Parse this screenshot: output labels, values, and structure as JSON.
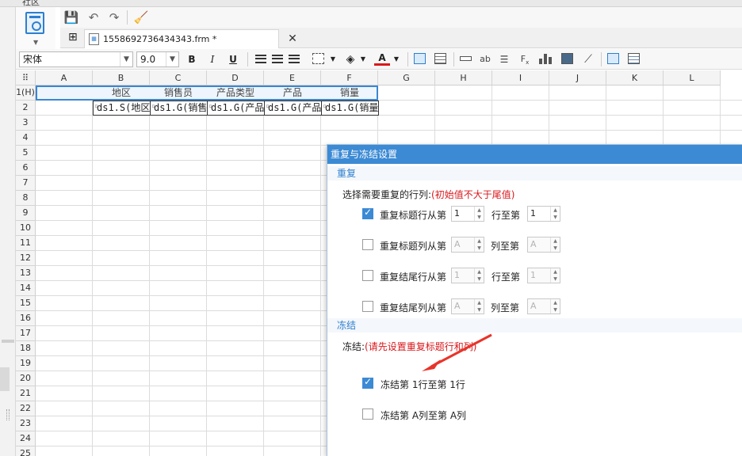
{
  "top_strip": {
    "text": "社区"
  },
  "tab": {
    "file_name": "1558692736434343.frm *"
  },
  "format_bar": {
    "font_name": "宋体",
    "font_size": "9.0"
  },
  "grid": {
    "columns": [
      "A",
      "B",
      "C",
      "D",
      "E",
      "F",
      "G",
      "H",
      "I",
      "J",
      "K",
      "L"
    ],
    "rows": [
      "1(H)",
      "2",
      "3",
      "4",
      "5",
      "6",
      "7",
      "8",
      "9",
      "10",
      "11",
      "12",
      "13",
      "14",
      "15",
      "16",
      "17",
      "18",
      "19",
      "20",
      "21",
      "22",
      "23",
      "24",
      "25"
    ],
    "header_row": [
      "地区",
      "销售员",
      "产品类型",
      "产品",
      "销量"
    ],
    "data_row": [
      "ds1.S(地区)",
      "ds1.G(销售",
      "ds1.G(产品",
      "ds1.G(产品)",
      "ds1.G(销量)"
    ]
  },
  "dialog": {
    "title": "重复与冻结设置",
    "repeat_section": "重复",
    "repeat_prompt": "选择需要重复的行列:",
    "repeat_hint": "(初始值不大于尾值)",
    "options": [
      {
        "label": "重复标题行从第",
        "checked": true,
        "from": "1",
        "to_label": "行至第",
        "to": "1",
        "enabled": true
      },
      {
        "label": "重复标题列从第",
        "checked": false,
        "from": "A",
        "to_label": "列至第",
        "to": "A",
        "enabled": false
      },
      {
        "label": "重复结尾行从第",
        "checked": false,
        "from": "1",
        "to_label": "行至第",
        "to": "1",
        "enabled": false
      },
      {
        "label": "重复结尾列从第",
        "checked": false,
        "from": "A",
        "to_label": "列至第",
        "to": "A",
        "enabled": false
      }
    ],
    "freeze_section": "冻结",
    "freeze_prompt": "冻结:",
    "freeze_hint": "(请先设置重复标题行和列)",
    "freeze_rows_label": "冻结第 1行至第 1行",
    "freeze_rows_checked": true,
    "freeze_cols_label": "冻结第 A列至第 A列",
    "freeze_cols_checked": false
  },
  "colors": {
    "accent": "#3c8ad4",
    "warning": "#d9181c",
    "arrow": "#e8342a"
  },
  "icons": [
    "template-icon",
    "save-icon",
    "undo-icon",
    "redo-icon",
    "brush-icon",
    "grid-icon",
    "file-icon",
    "close-icon",
    "bold-icon",
    "italic-icon",
    "underline-icon",
    "align-left-icon",
    "align-center-icon",
    "align-right-icon",
    "border-icon",
    "fill-color-icon",
    "font-color-icon"
  ]
}
